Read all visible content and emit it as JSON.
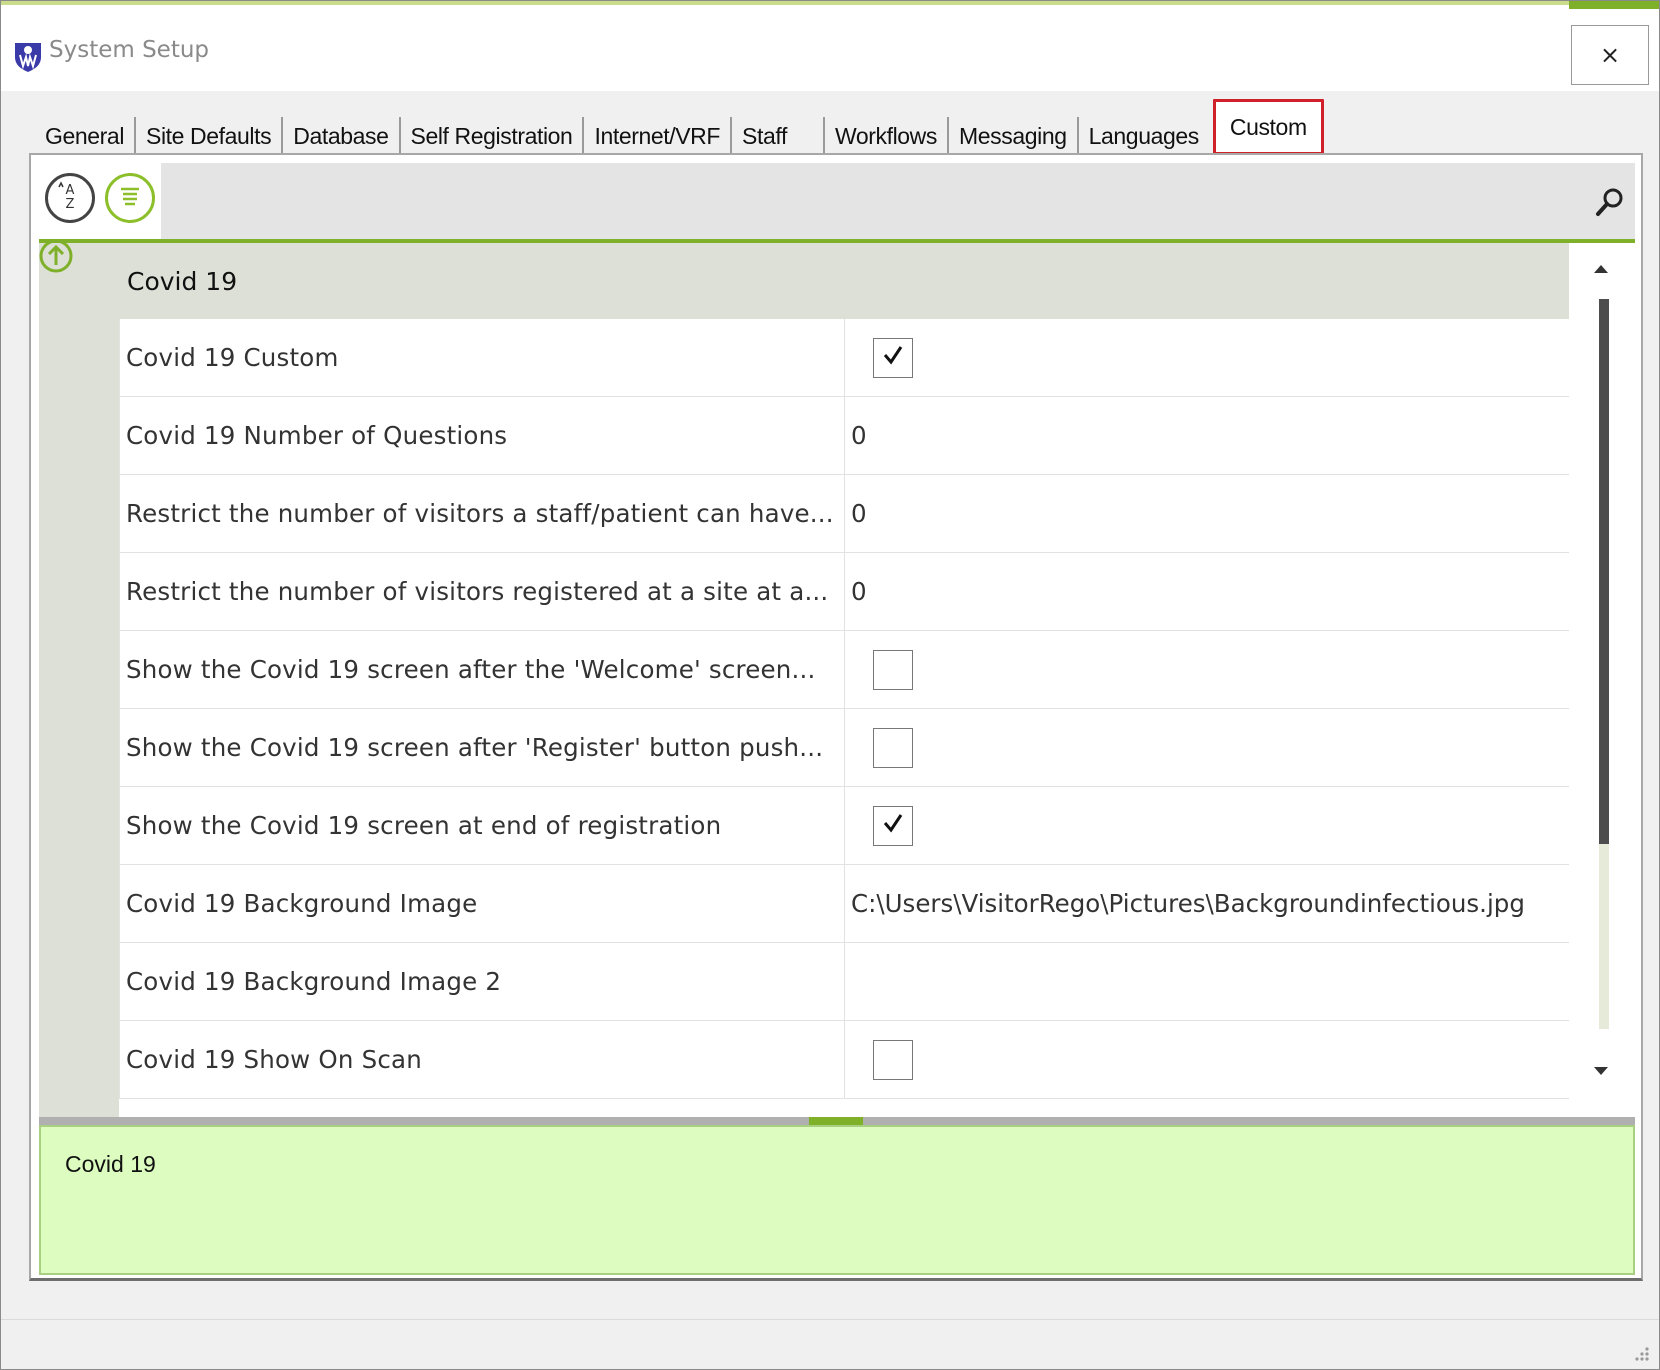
{
  "window": {
    "title": "System Setup",
    "close_glyph": "×"
  },
  "tabs": [
    {
      "label": "General"
    },
    {
      "label": "Site Defaults"
    },
    {
      "label": "Database"
    },
    {
      "label": "Self Registration"
    },
    {
      "label": "Internet/VRF"
    },
    {
      "label": "Staff"
    },
    {
      "label": "Workflows"
    },
    {
      "label": "Messaging"
    },
    {
      "label": "Languages"
    },
    {
      "label": "Custom",
      "active": true
    }
  ],
  "toolbar": {
    "sort_icon": "sort-alphabetical-icon",
    "category_icon": "categorized-view-icon",
    "search_icon": "search-icon",
    "search_value": ""
  },
  "grid": {
    "category": "Covid 19",
    "properties": [
      {
        "name": "Covid 19 Custom",
        "type": "checkbox",
        "checked": true
      },
      {
        "name": "Covid 19 Number of Questions",
        "type": "text",
        "value": "0"
      },
      {
        "name": "Restrict the number of visitors a staff/patient can have...",
        "type": "text",
        "value": "0"
      },
      {
        "name": "Restrict the number of visitors registered at a site at a...",
        "type": "text",
        "value": "0"
      },
      {
        "name": "Show the Covid 19 screen after the 'Welcome' screen...",
        "type": "checkbox",
        "checked": false
      },
      {
        "name": "Show the Covid 19 screen after 'Register' button push...",
        "type": "checkbox",
        "checked": false
      },
      {
        "name": "Show the Covid 19 screen at end of registration",
        "type": "checkbox",
        "checked": true
      },
      {
        "name": "Covid 19 Background Image",
        "type": "text",
        "value": "C:\\Users\\VisitorRego\\Pictures\\Backgroundinfectious.jpg"
      },
      {
        "name": "Covid 19 Background Image 2",
        "type": "text",
        "value": ""
      },
      {
        "name": "Covid 19 Show On Scan",
        "type": "checkbox",
        "checked": false
      }
    ]
  },
  "description": {
    "text": "Covid 19"
  },
  "colors": {
    "accent": "#7fb02a",
    "active_tab_border": "#d0202a",
    "description_bg": "#dcfcc0",
    "category_bg": "#dde0d6"
  }
}
